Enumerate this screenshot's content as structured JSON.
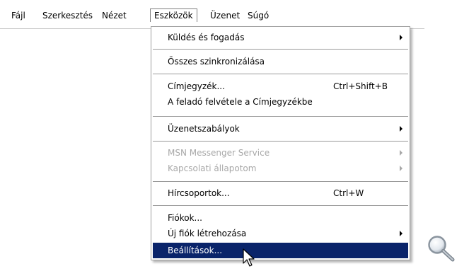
{
  "menubar": {
    "items": [
      "Fájl",
      "Szerkesztés",
      "Nézet",
      "Eszközök",
      "Üzenet",
      "Súgó"
    ]
  },
  "menu": {
    "items": [
      {
        "label": "Küldés és fogadás",
        "submenu": true
      },
      {
        "label": "Összes szinkronizálása"
      },
      {
        "label": "Címjegyzék...",
        "shortcut": "Ctrl+Shift+B"
      },
      {
        "label": "A feladó felvétele a Címjegyzékbe"
      },
      {
        "label": "Üzenetszabályok",
        "submenu": true
      },
      {
        "label": "MSN Messenger Service",
        "submenu": true,
        "disabled": true
      },
      {
        "label": "Kapcsolati állapotom",
        "submenu": true,
        "disabled": true
      },
      {
        "label": "Hírcsoportok...",
        "shortcut": "Ctrl+W"
      },
      {
        "label": "Fiókok..."
      },
      {
        "label": "Új fiók létrehozása",
        "submenu": true
      },
      {
        "label": "Beállítások...",
        "selected": true
      }
    ]
  },
  "icons": {
    "cursor": "mouse-pointer-icon",
    "magnifier": "magnifier-icon"
  },
  "colors": {
    "selection": "#0a246a",
    "disabled_text": "#a8a8a8"
  }
}
